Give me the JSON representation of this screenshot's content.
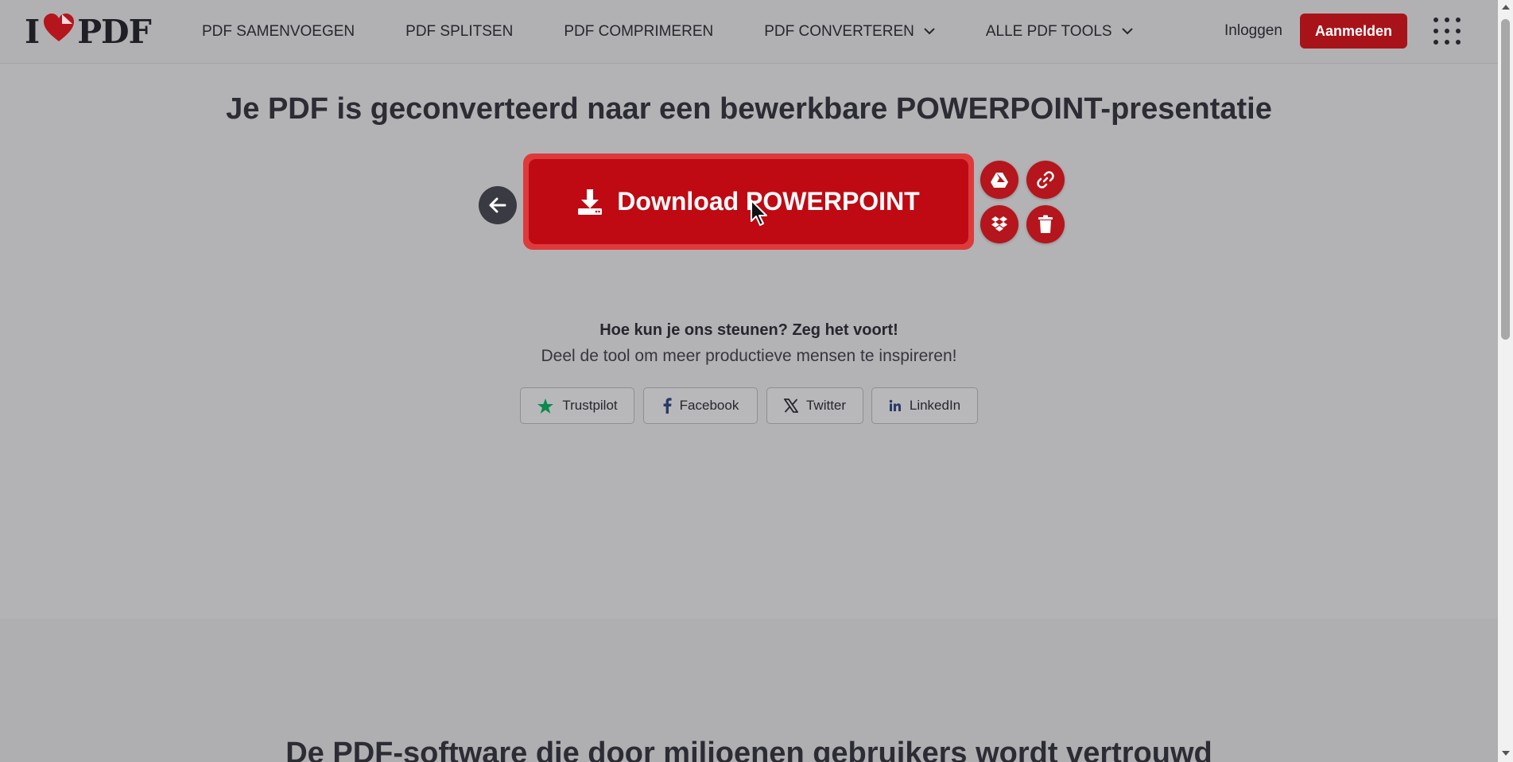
{
  "header": {
    "logo": {
      "left": "I",
      "right": "PDF"
    },
    "nav": [
      {
        "label": "PDF SAMENVOEGEN",
        "dropdown": false
      },
      {
        "label": "PDF SPLITSEN",
        "dropdown": false
      },
      {
        "label": "PDF COMPRIMEREN",
        "dropdown": false
      },
      {
        "label": "PDF CONVERTEREN",
        "dropdown": true
      },
      {
        "label": "ALLE PDF TOOLS",
        "dropdown": true
      }
    ],
    "login_label": "Inloggen",
    "signup_label": "Aanmelden"
  },
  "main": {
    "title": "Je PDF is geconverteerd naar een bewerkbare POWERPOINT-presentatie",
    "download_label": "Download POWERPOINT",
    "support_bold": "Hoe kun je ons steunen? Zeg het voort!",
    "support_text": "Deel de tool om meer productieve mensen te inspireren!",
    "social": [
      {
        "label": "Trustpilot",
        "icon": "star-icon"
      },
      {
        "label": "Facebook",
        "icon": "facebook-icon"
      },
      {
        "label": "Twitter",
        "icon": "x-icon"
      },
      {
        "label": "LinkedIn",
        "icon": "linkedin-icon"
      }
    ]
  },
  "lower": {
    "title": "De PDF-software die door miljoenen gebruikers wordt vertrouwd"
  },
  "colors": {
    "brand_red": "#bf0a13",
    "overlay_gray": "#b3b3b5",
    "text_dark": "#2c2c34"
  }
}
